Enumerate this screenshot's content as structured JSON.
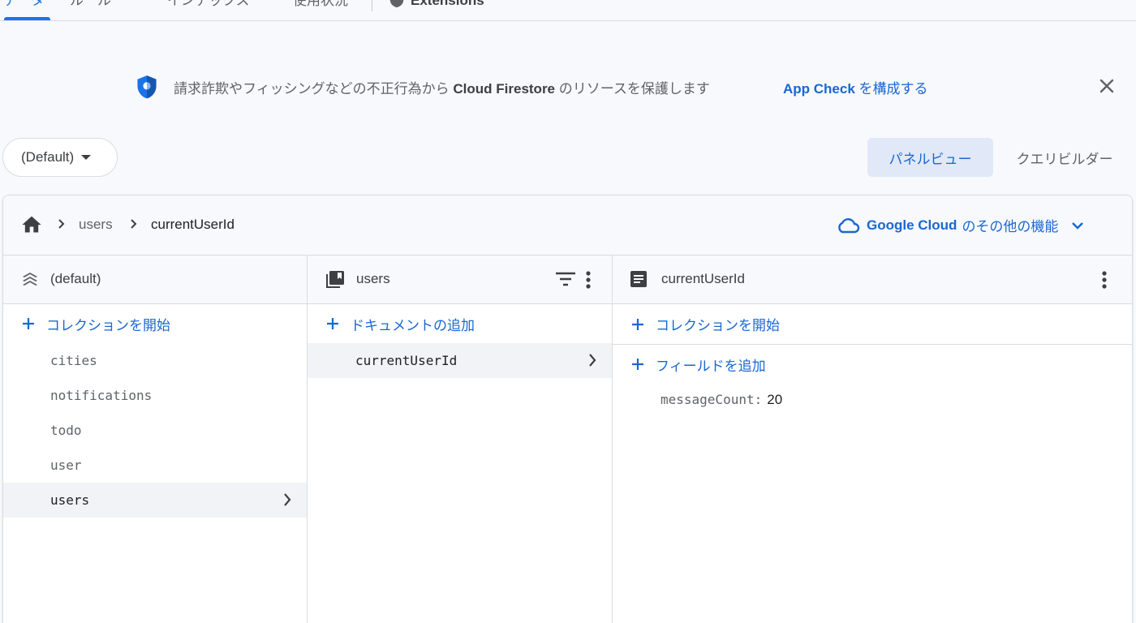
{
  "top_tabs": {
    "items": [
      "データ",
      "ルール",
      "インデックス",
      "使用状況"
    ],
    "extensions_label": "Extensions"
  },
  "banner": {
    "message_pre": "請求詐欺やフィッシングなどの不正行為から ",
    "message_product": "Cloud Firestore",
    "message_post": " のリソースを保護します",
    "link_bold": "App Check",
    "link_rest": " を構成する",
    "icons": [
      "shield-icon",
      "close-icon"
    ]
  },
  "db_selector": {
    "value": "(Default)"
  },
  "view_toggle": {
    "panel": "パネルビュー",
    "query": "クエリビルダー"
  },
  "breadcrumb": {
    "items": [
      "users",
      "currentUserId"
    ]
  },
  "gcloud_link": {
    "bold": "Google Cloud",
    "rest": "のその他の機能"
  },
  "columns": {
    "root": {
      "title": "(default)",
      "add_label": "コレクションを開始",
      "items": [
        "cities",
        "notifications",
        "todo",
        "user",
        "users"
      ],
      "selected": "users"
    },
    "collection": {
      "title": "users",
      "add_label": "ドキュメントの追加",
      "items": [
        "currentUserId"
      ],
      "selected": "currentUserId"
    },
    "document": {
      "title": "currentUserId",
      "add_collection_label": "コレクションを開始",
      "add_field_label": "フィールドを追加",
      "fields": [
        {
          "key": "messageCount:",
          "value": "20"
        }
      ]
    }
  },
  "colors": {
    "accent": "#1967d2",
    "background": "#f7f9fc",
    "selected_row": "#f1f3f6"
  }
}
